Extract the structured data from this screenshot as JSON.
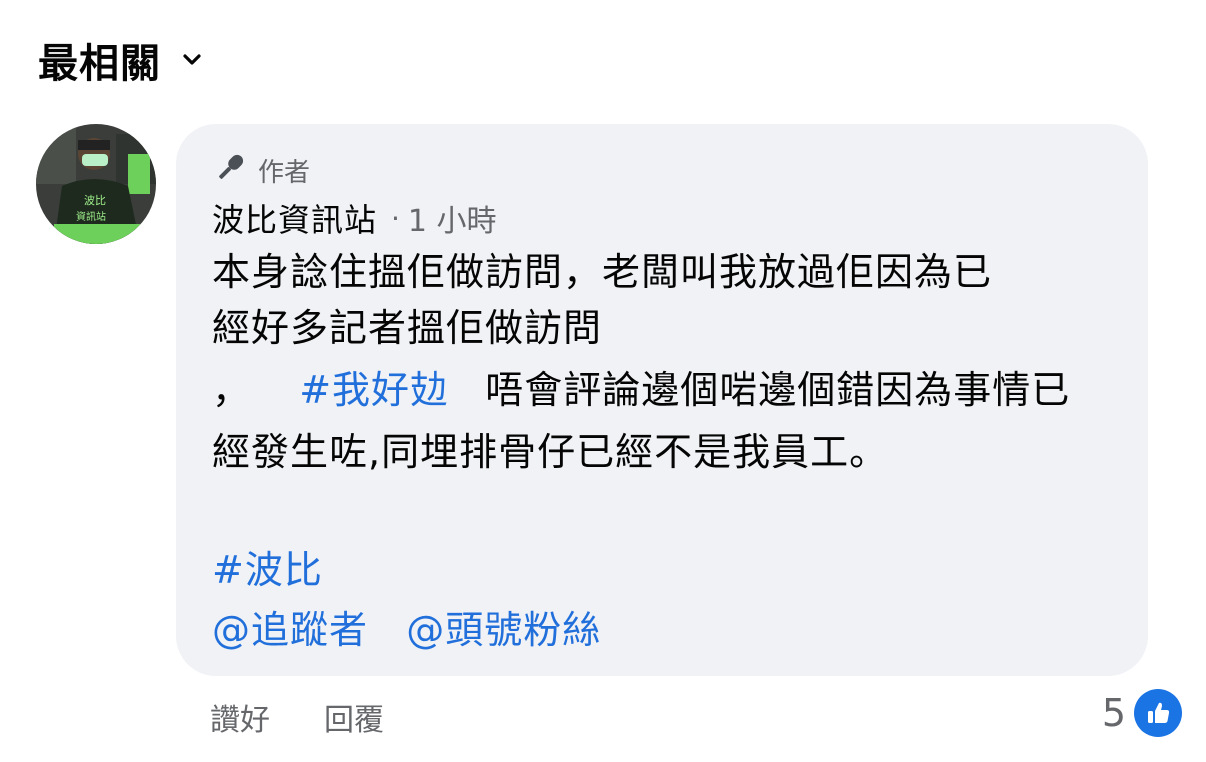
{
  "sort": {
    "label": "最相關",
    "chevron_icon": "chevron-down-icon"
  },
  "comment": {
    "avatar_icon": "page-avatar",
    "author_badge": {
      "icon": "microphone-icon",
      "label": "作者"
    },
    "author_name": "波比資訊站",
    "separator": "·",
    "time": "1 小時",
    "body": {
      "line1": "本身諗住搵佢做訪問，老闆叫我放過佢因為已",
      "line2": "經好多記者搵佢做訪問",
      "line3_prefix": "，",
      "line3_hashtag": "#我好攰",
      "line3_rest": "唔會評論邊個啱邊個錯因為事情已",
      "line4": "經發生咗,同埋排骨仔已經不是我員工。",
      "hashtag2": "#波比",
      "mention1": "@追蹤者",
      "mention2": "@頭號粉絲"
    }
  },
  "actions": {
    "like_label": "讚好",
    "reply_label": "回覆"
  },
  "reactions": {
    "count": "5",
    "icon": "like-icon",
    "color": "#1b74e4"
  },
  "colors": {
    "link": "#216fdb",
    "bubble_bg": "#f0f2f5",
    "secondary_text": "#65676b"
  }
}
